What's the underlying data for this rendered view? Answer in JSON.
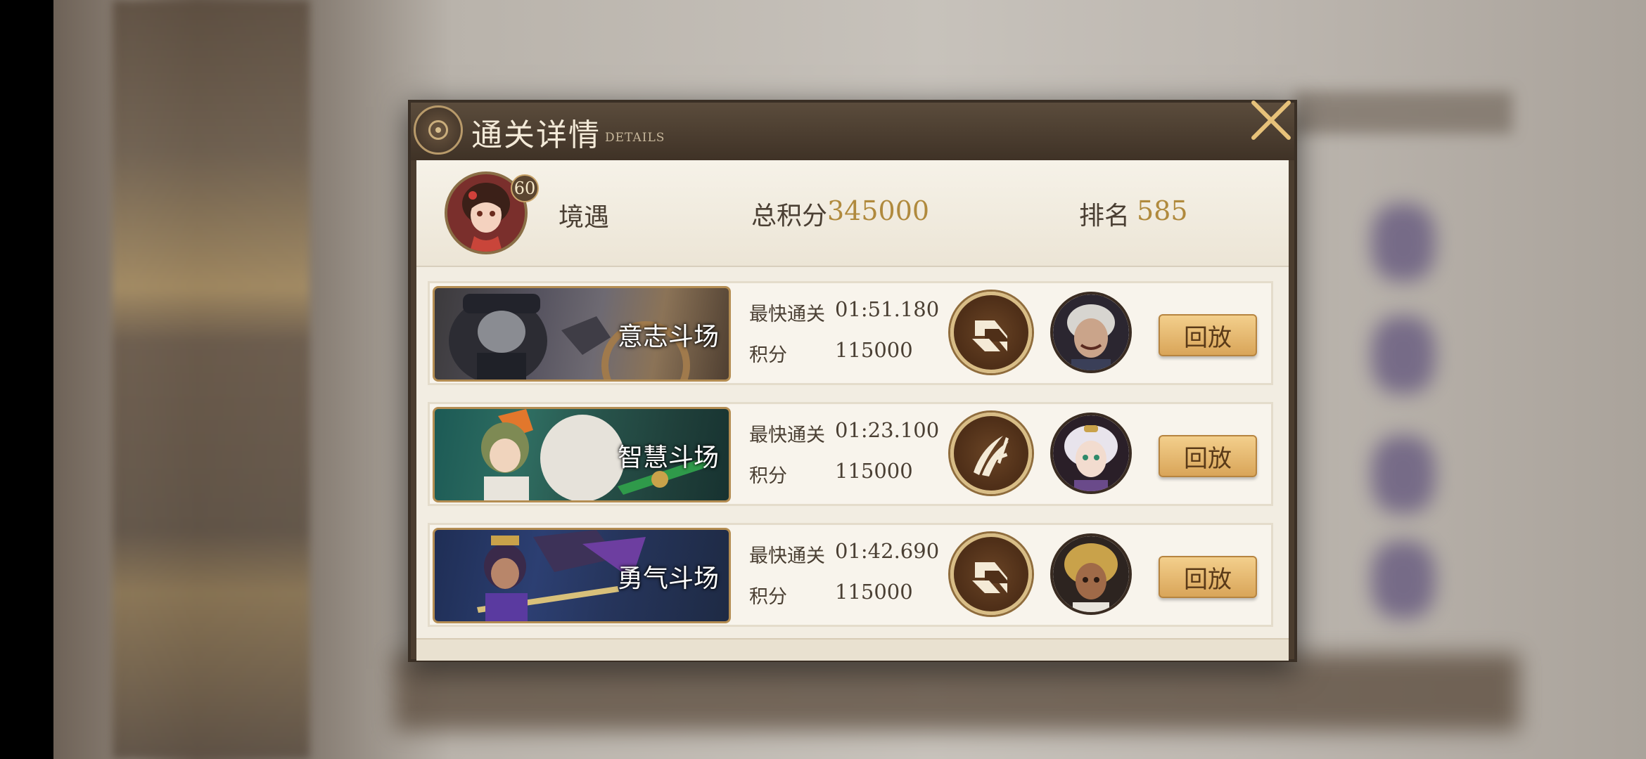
{
  "title": "通关详情",
  "title_sub": "DETAILS",
  "player": {
    "level": "60",
    "name": "境遇",
    "total_label": "总积分",
    "total_score": "345000",
    "rank_label": "排名",
    "rank": "585"
  },
  "arenas": [
    {
      "name": "意志斗场",
      "fastest_label": "最快通关",
      "fastest_time": "01:51.180",
      "score_label": "积分",
      "score": "115000",
      "class_icon": "chevron-class-icon",
      "replay_label": "回放"
    },
    {
      "name": "智慧斗场",
      "fastest_label": "最快通关",
      "fastest_time": "01:23.100",
      "score_label": "积分",
      "score": "115000",
      "class_icon": "slash-class-icon",
      "replay_label": "回放"
    },
    {
      "name": "勇气斗场",
      "fastest_label": "最快通关",
      "fastest_time": "01:42.690",
      "score_label": "积分",
      "score": "115000",
      "class_icon": "chevron-class-icon",
      "replay_label": "回放"
    }
  ]
}
